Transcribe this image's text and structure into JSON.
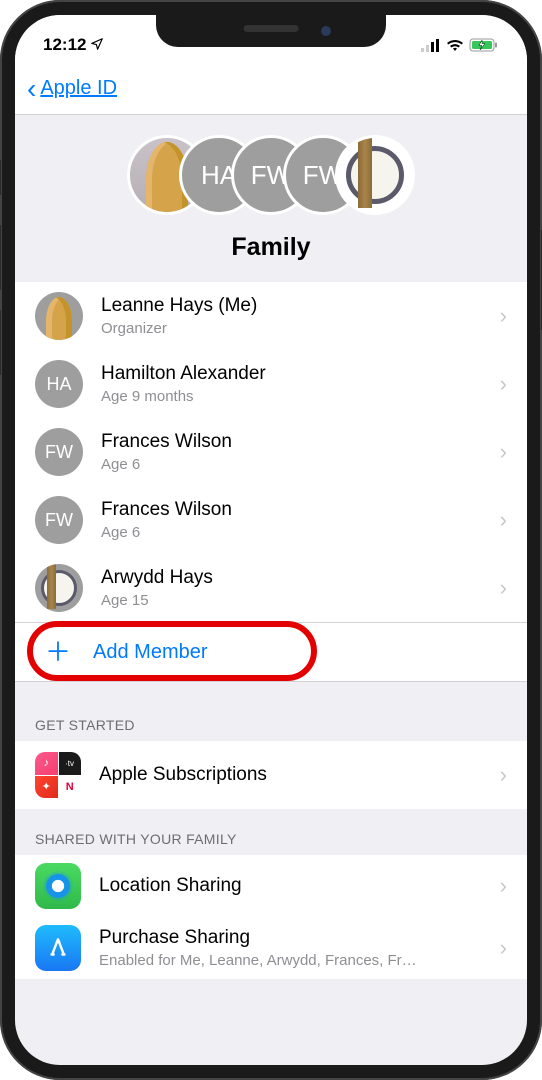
{
  "status_bar": {
    "time": "12:12"
  },
  "nav": {
    "back_label": "Apple ID"
  },
  "header": {
    "title": "Family",
    "avatars": [
      {
        "type": "giraffe",
        "label": ""
      },
      {
        "type": "initials",
        "label": "HA"
      },
      {
        "type": "initials",
        "label": "FW"
      },
      {
        "type": "initials",
        "label": "FW"
      },
      {
        "type": "plate",
        "label": ""
      }
    ]
  },
  "members": [
    {
      "name": "Leanne Hays  (Me)",
      "subtitle": "Organizer",
      "avatar_type": "giraffe",
      "avatar_label": ""
    },
    {
      "name": "Hamilton Alexander",
      "subtitle": "Age 9 months",
      "avatar_type": "initials",
      "avatar_label": "HA"
    },
    {
      "name": "Frances Wilson",
      "subtitle": "Age 6",
      "avatar_type": "initials",
      "avatar_label": "FW"
    },
    {
      "name": "Frances Wilson",
      "subtitle": "Age 6",
      "avatar_type": "initials",
      "avatar_label": "FW"
    },
    {
      "name": "Arwydd Hays",
      "subtitle": "Age 15",
      "avatar_type": "plate",
      "avatar_label": ""
    }
  ],
  "add_member": {
    "label": "Add Member"
  },
  "sections": {
    "get_started": {
      "header": "GET STARTED",
      "items": [
        {
          "title": "Apple Subscriptions"
        }
      ]
    },
    "shared": {
      "header": "SHARED WITH YOUR FAMILY",
      "items": [
        {
          "title": "Location Sharing",
          "subtitle": ""
        },
        {
          "title": "Purchase Sharing",
          "subtitle": "Enabled for Me, Leanne, Arwydd, Frances, Fr…"
        }
      ]
    }
  }
}
